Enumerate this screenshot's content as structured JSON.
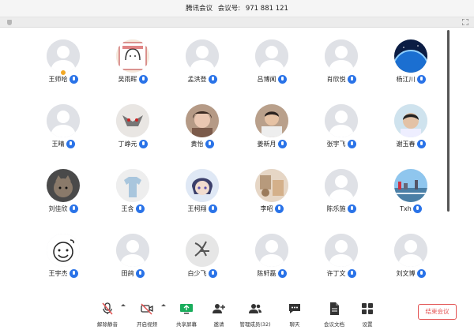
{
  "window": {
    "app_name": "腾讯会议",
    "meeting_label": "会议号:",
    "meeting_id": "971 881 121"
  },
  "participants": [
    {
      "name": "王师哈",
      "mic": false,
      "host": true,
      "avatar": "placeholder"
    },
    {
      "name": "吴雨晖",
      "mic": true,
      "host": false,
      "avatar": "drawing-girl"
    },
    {
      "name": "孟洪登",
      "mic": true,
      "host": false,
      "avatar": "placeholder"
    },
    {
      "name": "吕博闻",
      "mic": true,
      "host": false,
      "avatar": "placeholder"
    },
    {
      "name": "肖欣悦",
      "mic": true,
      "host": false,
      "avatar": "placeholder"
    },
    {
      "name": "杨江川",
      "mic": false,
      "host": false,
      "avatar": "earth"
    },
    {
      "name": "王晴",
      "mic": true,
      "host": false,
      "avatar": "placeholder"
    },
    {
      "name": "丁峥元",
      "mic": true,
      "host": false,
      "avatar": "cat-sketch"
    },
    {
      "name": "黄怡",
      "mic": true,
      "host": false,
      "avatar": "photo-girl"
    },
    {
      "name": "姜新月",
      "mic": true,
      "host": false,
      "avatar": "photo-boy"
    },
    {
      "name": "张宇飞",
      "mic": true,
      "host": false,
      "avatar": "placeholder"
    },
    {
      "name": "谢玉春",
      "mic": true,
      "host": false,
      "avatar": "photo-boy2"
    },
    {
      "name": "刘佳欣",
      "mic": true,
      "host": false,
      "avatar": "photo-cat"
    },
    {
      "name": "王含",
      "mic": true,
      "host": false,
      "avatar": "shirt"
    },
    {
      "name": "王柯翔",
      "mic": true,
      "host": false,
      "avatar": "anime"
    },
    {
      "name": "李昭",
      "mic": false,
      "host": false,
      "avatar": "room"
    },
    {
      "name": "陈乐施",
      "mic": true,
      "host": false,
      "avatar": "placeholder"
    },
    {
      "name": "Txh",
      "mic": true,
      "host": false,
      "avatar": "city"
    },
    {
      "name": "王宇杰",
      "mic": true,
      "host": false,
      "avatar": "doodle"
    },
    {
      "name": "田鸽",
      "mic": true,
      "host": false,
      "avatar": "placeholder"
    },
    {
      "name": "白少飞",
      "mic": true,
      "host": false,
      "avatar": "calligraphy"
    },
    {
      "name": "陈轩磊",
      "mic": true,
      "host": false,
      "avatar": "placeholder"
    },
    {
      "name": "许丁文",
      "mic": true,
      "host": false,
      "avatar": "placeholder"
    },
    {
      "name": "刘文博",
      "mic": true,
      "host": false,
      "avatar": "placeholder"
    }
  ],
  "toolbar": {
    "unmute": "解除静音",
    "start_video": "开启视频",
    "share_screen": "共享屏幕",
    "invite": "邀请",
    "manage_members": "管理成员(32)",
    "chat": "聊天",
    "meeting_docs": "会议文档",
    "settings": "设置",
    "end_meeting": "结束会议"
  },
  "colors": {
    "accent": "#2a73e8",
    "danger": "#e35353",
    "share_green": "#1aad5c",
    "host_badge": "#f2a825"
  }
}
